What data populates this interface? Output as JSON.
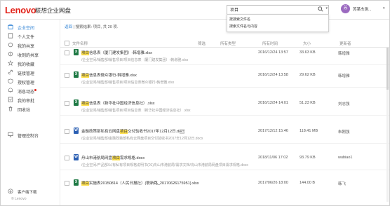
{
  "app": {
    "logo": "Lenovo",
    "name": "联想企业网盘"
  },
  "search": {
    "value": "项目",
    "suggestions": [
      "按搜索文件名",
      "搜索文件名与内容"
    ]
  },
  "user": {
    "avatar_letter": "苏",
    "name": "苏某杰测..."
  },
  "sidebar": {
    "items": [
      {
        "label": "企业空间",
        "icon": "enterprise-space-icon",
        "active": true
      },
      {
        "label": "个人文件",
        "icon": "personal-files-icon"
      },
      {
        "label": "我的共享",
        "icon": "my-share-icon"
      },
      {
        "label": "收到的共享",
        "icon": "received-share-icon"
      },
      {
        "label": "我的收藏",
        "icon": "favorites-icon"
      },
      {
        "label": "链接管理",
        "icon": "link-icon"
      },
      {
        "label": "授权管理",
        "icon": "permission-icon"
      },
      {
        "label": "消息动态",
        "icon": "message-icon",
        "dot": true
      },
      {
        "label": "我的审批",
        "icon": "approval-icon"
      },
      {
        "label": "回收站",
        "icon": "recycle-icon"
      },
      {
        "label": "管理控制台",
        "icon": "admin-console-icon"
      }
    ],
    "footer": {
      "download": "客户端下载",
      "copyright": "© Lenovo"
    }
  },
  "breadcrumb": {
    "root": "返回",
    "sep": "|",
    "summary": "搜索结果: 项目, 共 20 项."
  },
  "table": {
    "headers": {
      "name": "文件名称",
      "filter": "筛选",
      "type": "所有类型",
      "modified": "所有时间",
      "size": "大小",
      "owner": "更新者"
    },
    "rows": [
      {
        "type": "xls",
        "name_pre": "",
        "name_hl": "项目",
        "name_post": "信息表（厦门建发集团）-韩增雅.xlsx",
        "path": "/企业空间/销售部/销售项目/项目信息表（厦门建发集团）-韩增雅.xlsx",
        "modified": "2016/12/24 13:57",
        "size": "33.63 KB",
        "owner": "韩增雅"
      },
      {
        "type": "xls",
        "name_pre": "",
        "name_hl": "项目",
        "name_post": "信息表微众银行-韩增雅.xlsx",
        "path": "/企业空间/销售部/销售项目/项目信息表微众银行-韩增雅.xlsx",
        "modified": "2016/12/24 13:58",
        "size": "29.62 KB",
        "owner": "韩增雅"
      },
      {
        "type": "xls",
        "name_pre": "",
        "name_hl": "项目",
        "name_post": "信息表（新华社中国经济信息社）.xlsx",
        "path": "/企业空间/销售部/销售项目/项目信息表（新华社中国经济信息社）.xlsx",
        "modified": "2016/12/24 14:01",
        "size": "51.23 KB",
        "owner": "刘志强"
      },
      {
        "type": "doc",
        "name_pre": "金融政策部私有云网盘",
        "name_hl": "项目",
        "name_post": "交付验收书2017年12月12日.docx",
        "badge": "1",
        "path": "/企业空间/销售部/金融政策部私有云网盘项目交付验收书2017年12月12日.docx",
        "modified": "2017/12/12 15:46",
        "size": "118.41 MB",
        "owner": "朱刚强"
      },
      {
        "type": "doc",
        "name_pre": "舟山市港航局网盘",
        "name_hl": "项目",
        "name_post": "需求规格.docx",
        "path": "/企业空间/产品部/公有私有项目规格说明书(01)舟山市港航局/需求文档/舟山市港航局网盘项目需求规格.docx",
        "modified": "2018/11/06 17:02",
        "size": "93.79 KB",
        "owner": "wubiao1"
      },
      {
        "type": "xls",
        "name_pre": "",
        "name_hl": "项目",
        "name_post": "实施表20150814（人民日报社）(联新路_20170626175951).xlsx",
        "path": "",
        "modified": "2017/06/26 18:00",
        "size": "144.00 B",
        "owner": "韩飞"
      }
    ]
  },
  "colors": {
    "accent": "#2a7fd4",
    "brand": "#e2231a",
    "highlight": "#ffe04d"
  }
}
